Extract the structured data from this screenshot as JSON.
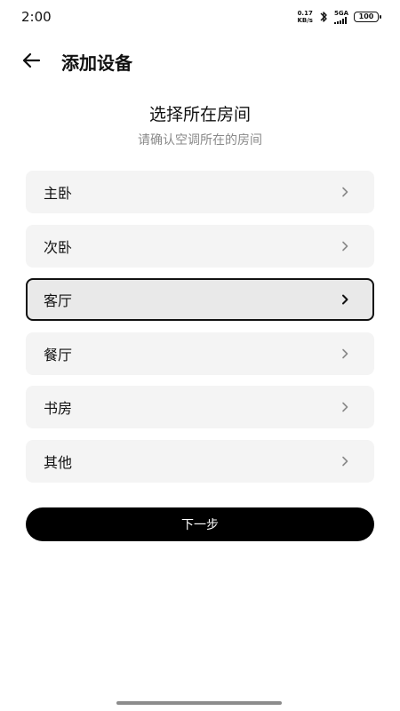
{
  "status_bar": {
    "time": "2:00",
    "net_speed_value": "0.17",
    "net_speed_unit": "KB/s",
    "network_type": "5GA",
    "battery": "100",
    "icons": [
      "bluetooth-icon",
      "signal-icon",
      "battery-icon"
    ]
  },
  "header": {
    "back_icon": "arrow-left-icon",
    "title": "添加设备"
  },
  "page": {
    "title": "选择所在房间",
    "subtitle": "请确认空调所在的房间"
  },
  "rooms": [
    {
      "label": "主卧",
      "selected": false
    },
    {
      "label": "次卧",
      "selected": false
    },
    {
      "label": "客厅",
      "selected": true
    },
    {
      "label": "餐厅",
      "selected": false
    },
    {
      "label": "书房",
      "selected": false
    },
    {
      "label": "其他",
      "selected": false
    }
  ],
  "next_button": {
    "label": "下一步"
  },
  "colors": {
    "item_bg": "#f4f4f4",
    "selected_bg": "#e9e9e9",
    "selected_border": "#111111",
    "primary_button": "#000000",
    "subtitle": "#8a8a8a",
    "chevron": "#8a8a8a"
  }
}
